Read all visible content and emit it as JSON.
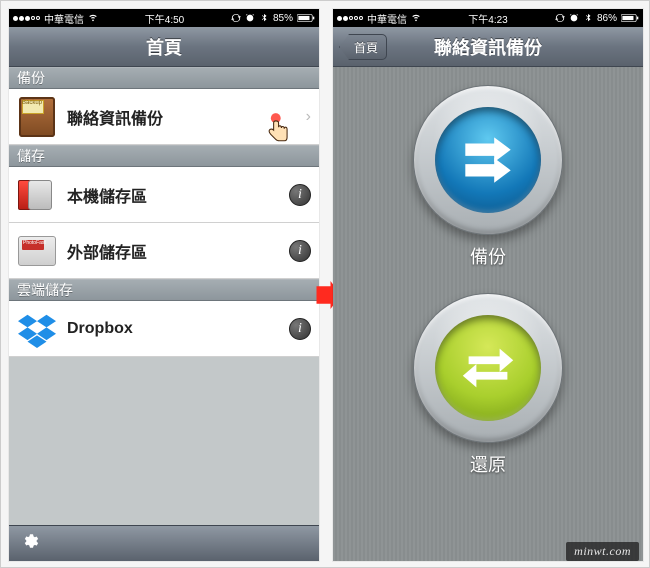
{
  "left": {
    "status": {
      "carrier": "中華電信",
      "time": "下午4:50",
      "battery": "85%"
    },
    "nav": {
      "title": "首頁"
    },
    "sections": [
      {
        "header": "備份",
        "rows": [
          {
            "label": "聯絡資訊備份",
            "accessory": "disclosure",
            "icon": "backup-book"
          }
        ]
      },
      {
        "header": "儲存",
        "rows": [
          {
            "label": "本機儲存區",
            "accessory": "info",
            "icon": "internal-hdd"
          },
          {
            "label": "外部儲存區",
            "accessory": "info",
            "icon": "sd-card"
          }
        ]
      },
      {
        "header": "雲端儲存",
        "rows": [
          {
            "label": "Dropbox",
            "accessory": "info",
            "icon": "dropbox"
          }
        ]
      }
    ],
    "toolbar": {
      "gear": "gear-icon"
    }
  },
  "right": {
    "status": {
      "carrier": "中華電信",
      "time": "下午4:23",
      "battery": "86%"
    },
    "nav": {
      "back": "首頁",
      "title": "聯絡資訊備份"
    },
    "buttons": [
      {
        "label": "備份",
        "style": "blue",
        "icon": "arrows-right"
      },
      {
        "label": "還原",
        "style": "green",
        "icon": "arrows-cycle"
      }
    ]
  },
  "watermark": "minwt.com"
}
